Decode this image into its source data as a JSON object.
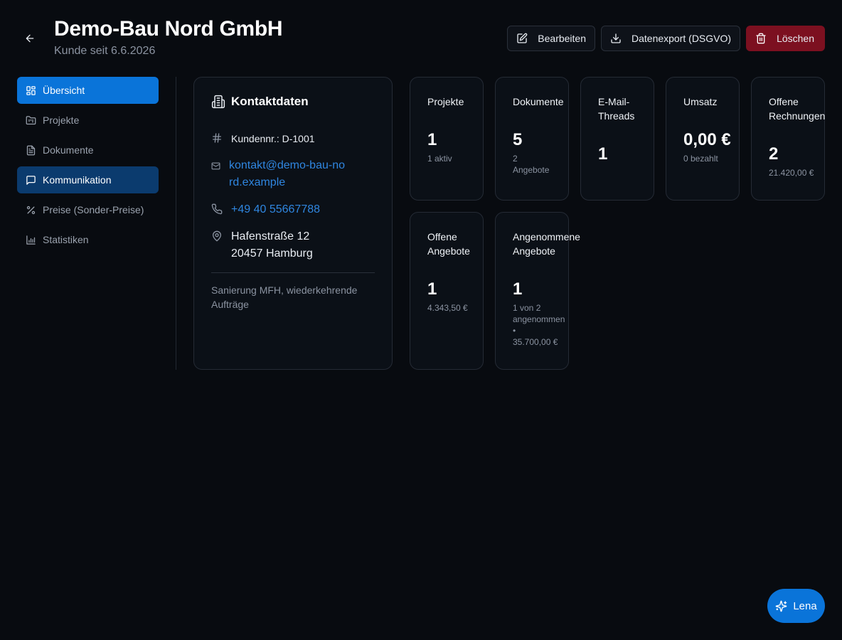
{
  "header": {
    "title": "Demo-Bau Nord GmbH",
    "subtitle": "Kunde seit 6.6.2026",
    "actions": {
      "edit": "Bearbeiten",
      "export": "Datenexport (DSGVO)",
      "delete": "Löschen"
    }
  },
  "sidebar": {
    "items": [
      {
        "label": "Übersicht",
        "icon": "layout-dashboard-icon",
        "state": "active"
      },
      {
        "label": "Projekte",
        "icon": "folder-kanban-icon",
        "state": "default"
      },
      {
        "label": "Dokumente",
        "icon": "file-text-icon",
        "state": "default"
      },
      {
        "label": "Kommunikation",
        "icon": "message-square-icon",
        "state": "selected"
      },
      {
        "label": "Preise (Sonder-Preise)",
        "icon": "percent-icon",
        "state": "default"
      },
      {
        "label": "Statistiken",
        "icon": "bar-chart-icon",
        "state": "default"
      }
    ]
  },
  "contact": {
    "title": "Kontaktdaten",
    "customer_number": "Kundennr.: D-1001",
    "email": "kontakt@demo-bau-nord.example",
    "phone": "+49 40 55667788",
    "address_line1": "Hafenstraße 12",
    "address_line2": "20457 Hamburg",
    "notes": "Sanierung MFH, wiederkehrende Aufträge"
  },
  "stats": {
    "projekte": {
      "label": "Projekte",
      "value": "1",
      "sub": "1 aktiv"
    },
    "dokumente": {
      "label": "Dokumente",
      "value": "5",
      "sub": "2\nAngebote"
    },
    "email_threads": {
      "label": "E-Mail-\nThreads",
      "value": "1",
      "sub": ""
    },
    "umsatz": {
      "label": "Umsatz",
      "value": "0,00 €",
      "sub": "0 bezahlt"
    },
    "offene_rechnungen": {
      "label": "Offene\nRechnungen",
      "value": "2",
      "sub": "21.420,00 €"
    },
    "offene_angebote": {
      "label": "Offene\nAngebote",
      "value": "1",
      "sub": "4.343,50 €"
    },
    "angenommene_angebote": {
      "label": "Angenommene\nAngebote",
      "value": "1",
      "sub": "1 von 2\nangenommen\n•\n35.700,00 €"
    }
  },
  "assistant": {
    "label": "Lena",
    "icon": "sparkles-icon"
  },
  "colors": {
    "background": "#080b10",
    "card": "#0b1017",
    "accent": "#0a74d9",
    "nav_selected": "#0b3b6e",
    "danger": "#7c1020",
    "link": "#2f86e0"
  }
}
